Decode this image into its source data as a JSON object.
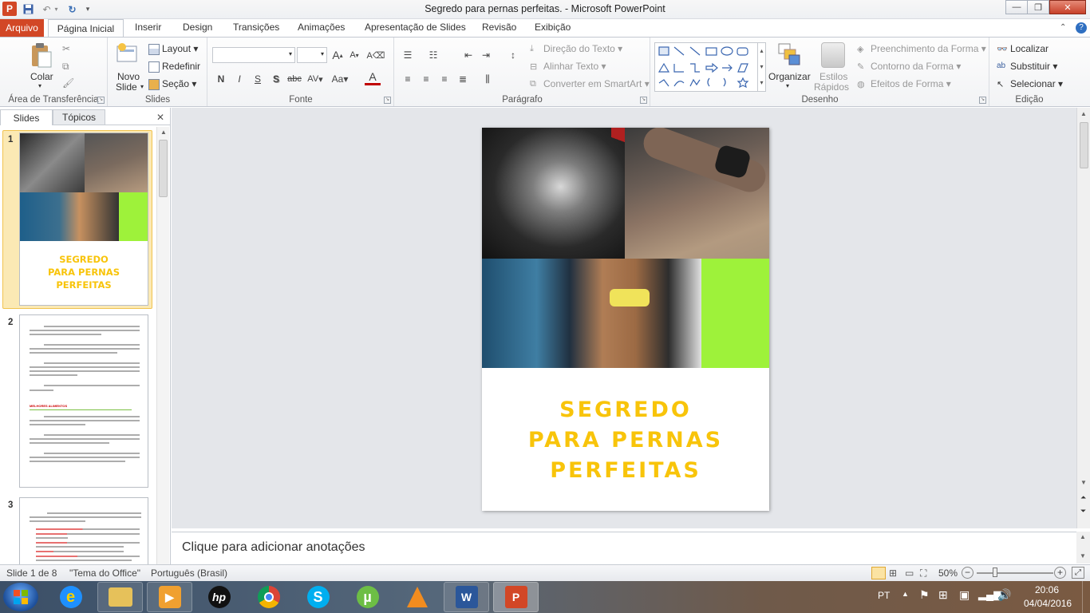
{
  "window": {
    "title": "Segredo para pernas perfeitas. - Microsoft PowerPoint",
    "app_letter": "P"
  },
  "tabs": [
    "Arquivo",
    "Página Inicial",
    "Inserir",
    "Design",
    "Transições",
    "Animações",
    "Apresentação de Slides",
    "Revisão",
    "Exibição"
  ],
  "ribbon": {
    "clipboard": {
      "paste": "Colar",
      "label": "Área de Transferência"
    },
    "slides": {
      "new_slide_1": "Novo",
      "new_slide_2": "Slide",
      "layout": "Layout",
      "reset": "Redefinir",
      "section": "Seção",
      "label": "Slides"
    },
    "font": {
      "label": "Fonte",
      "bold": "N",
      "italic": "I",
      "underline": "S",
      "shadow": "S",
      "strike": "abc",
      "spacing": "AV",
      "case": "Aa",
      "grow": "A",
      "shrink": "A",
      "color": "A"
    },
    "paragraph": {
      "text_direction": "Direção do Texto",
      "align_text": "Alinhar Texto",
      "convert_smartart": "Converter em SmartArt",
      "label": "Parágrafo"
    },
    "drawing": {
      "arrange": "Organizar",
      "quick_styles_1": "Estilos",
      "quick_styles_2": "Rápidos",
      "shape_fill": "Preenchimento da Forma",
      "shape_outline": "Contorno da Forma",
      "shape_effects": "Efeitos de Forma",
      "label": "Desenho"
    },
    "editing": {
      "find": "Localizar",
      "replace": "Substituir",
      "select": "Selecionar",
      "label": "Edição"
    }
  },
  "panel": {
    "tab_slides": "Slides",
    "tab_outline": "Tópicos",
    "thumbs": [
      {
        "num": "1",
        "title_lines": [
          "SEGREDO",
          "PARA PERNAS",
          "PERFEITAS"
        ]
      },
      {
        "num": "2",
        "heading": "MELHORES ALIMENTOS"
      },
      {
        "num": "3"
      }
    ]
  },
  "slide": {
    "title_lines": [
      "SEGREDO",
      "PARA PERNAS",
      "PERFEITAS"
    ],
    "accent_color": "#9ef23a",
    "title_color": "#f8c40a"
  },
  "notes": {
    "placeholder": "Clique para adicionar anotações"
  },
  "status": {
    "slide_of": "Slide 1 de 8",
    "theme": "\"Tema do Office\"",
    "language": "Português (Brasil)",
    "zoom": "50%"
  },
  "taskbar": {
    "apps": [
      "start",
      "internet-explorer",
      "file-explorer",
      "media-player",
      "hp",
      "chrome",
      "skype",
      "utorrent",
      "vlc",
      "word",
      "powerpoint"
    ],
    "lang": "PT",
    "time": "20:06",
    "date": "04/04/2016"
  }
}
